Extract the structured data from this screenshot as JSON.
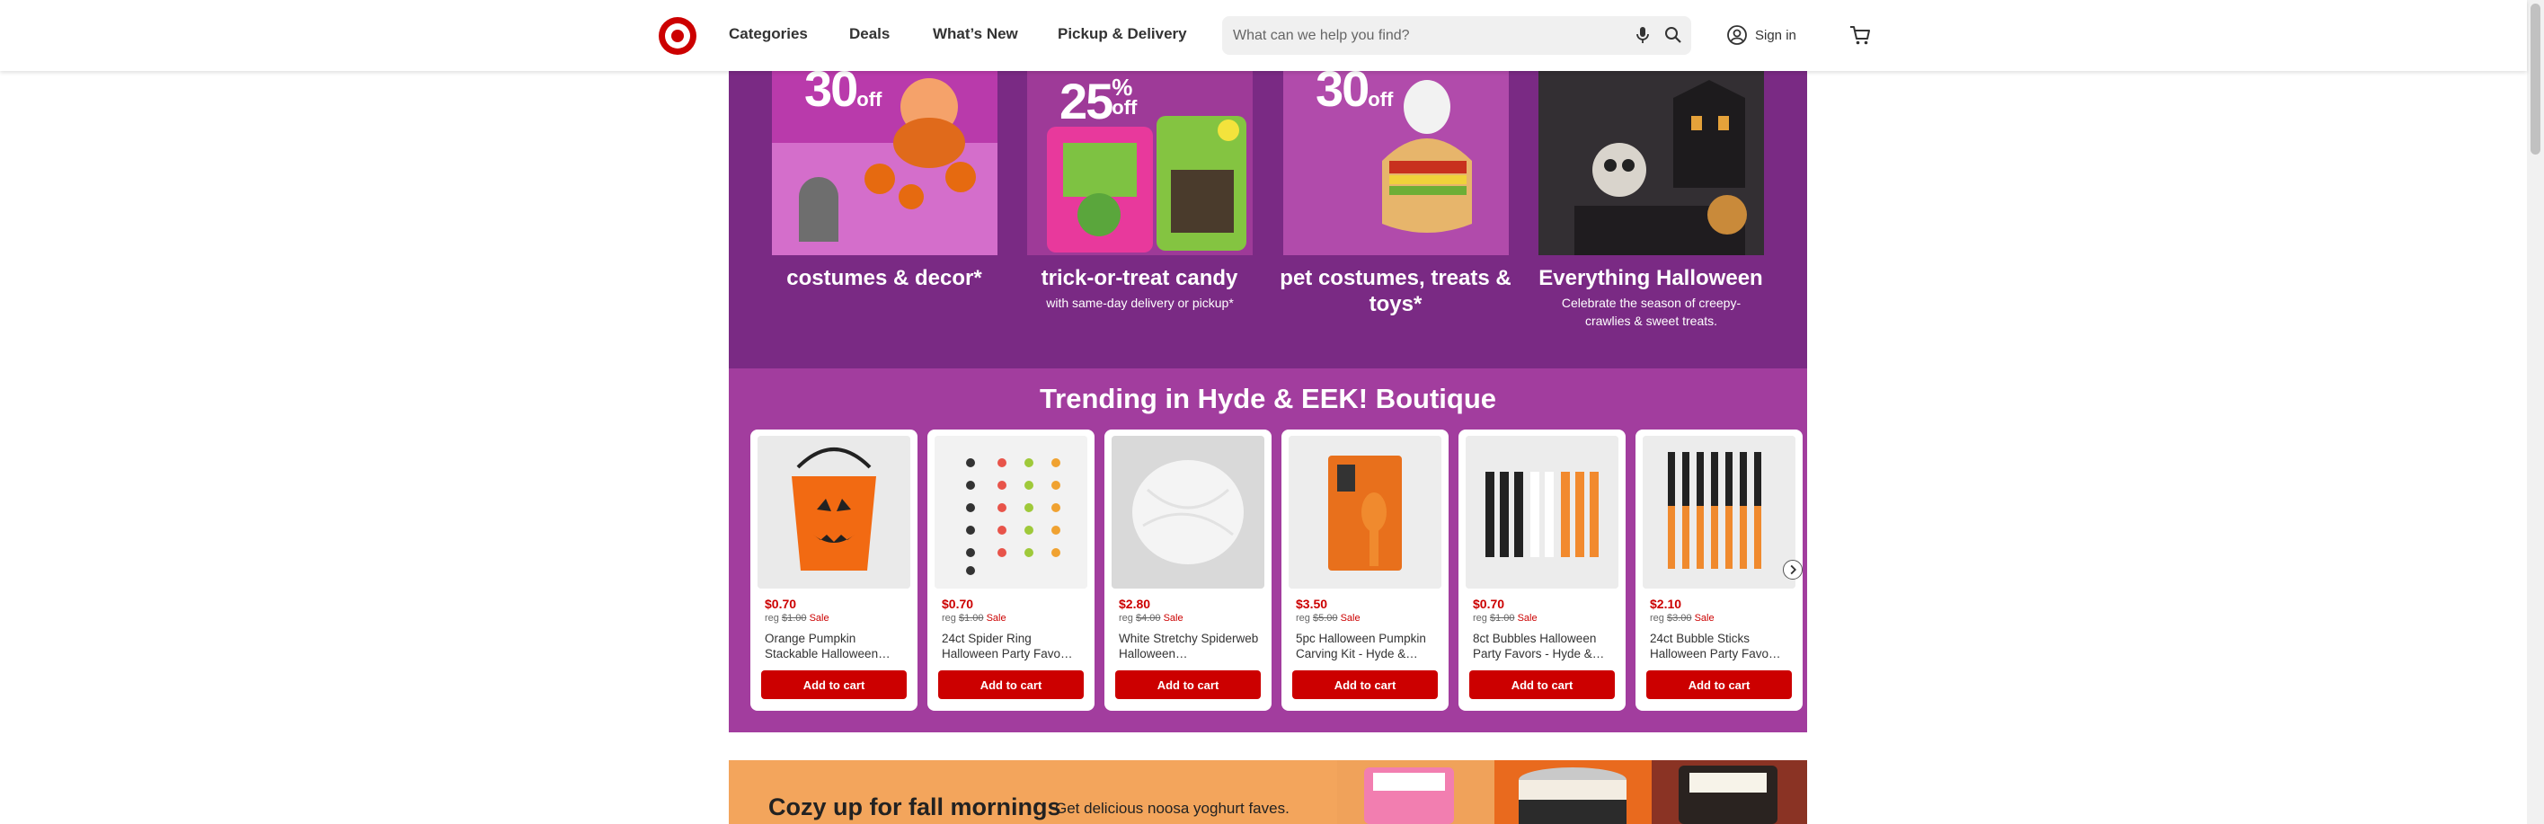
{
  "header": {
    "nav": [
      "Categories",
      "Deals",
      "What’s New",
      "Pickup & Delivery"
    ],
    "search_placeholder": "What can we help you find?",
    "signin_label": "Sign in",
    "brand_color": "#cc0000"
  },
  "hero": {
    "bg_color": "#7a2a84",
    "tiles": [
      {
        "pct": "30",
        "sup": "",
        "off": "off",
        "title": "costumes & decor*",
        "subtitle": ""
      },
      {
        "pct": "25",
        "sup": "%",
        "off": "off",
        "title": "trick-or-treat candy",
        "subtitle": "with same-day delivery or pickup*"
      },
      {
        "pct": "30",
        "sup": "",
        "off": "off",
        "title": "pet costumes, treats & toys*",
        "subtitle": ""
      },
      {
        "pct": "",
        "sup": "",
        "off": "",
        "title": "Everything Halloween",
        "subtitle": "Celebrate the season of creepy-crawlies & sweet treats."
      }
    ]
  },
  "trending": {
    "title": "Trending in Hyde & EEK! Boutique",
    "bg_color": "#a23d9e",
    "reg_prefix": "reg",
    "sale_label": "Sale",
    "add_to_cart_label": "Add to cart",
    "products": [
      {
        "price": "$0.70",
        "reg": "$1.00",
        "name": "Orange Pumpkin Stackable Halloween…"
      },
      {
        "price": "$0.70",
        "reg": "$1.00",
        "name": "24ct Spider Ring Halloween Party Favo…"
      },
      {
        "price": "$2.80",
        "reg": "$4.00",
        "name": "White Stretchy Spiderweb Halloween…"
      },
      {
        "price": "$3.50",
        "reg": "$5.00",
        "name": "5pc Halloween Pumpkin Carving Kit - Hyde &…"
      },
      {
        "price": "$0.70",
        "reg": "$1.00",
        "name": "8ct Bubbles Halloween Party Favors - Hyde &…"
      },
      {
        "price": "$2.10",
        "reg": "$3.00",
        "name": "24ct Bubble Sticks Halloween Party Favo…"
      }
    ]
  },
  "promo": {
    "title": "Cozy up for fall mornings",
    "subtitle": "Get delicious noosa yoghurt faves.",
    "bg_color": "#f3a55c"
  }
}
